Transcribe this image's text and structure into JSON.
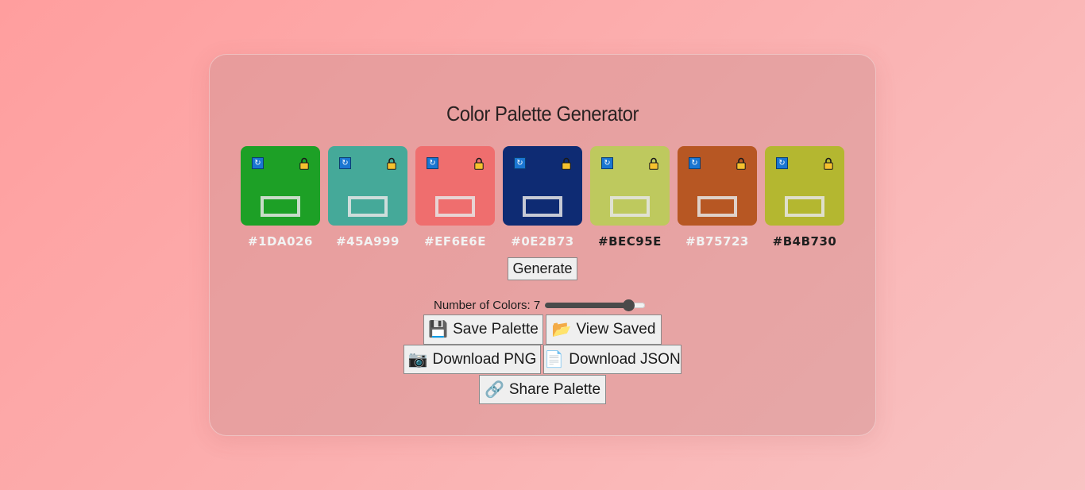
{
  "title": "Color Palette Generator",
  "swatches": [
    {
      "hex": "#1DA026",
      "text_color": "#f2f2f2"
    },
    {
      "hex": "#45A999",
      "text_color": "#f2f2f2"
    },
    {
      "hex": "#EF6E6E",
      "text_color": "#f2f2f2"
    },
    {
      "hex": "#0E2B73",
      "text_color": "#f2f2f2"
    },
    {
      "hex": "#BEC95E",
      "text_color": "#1e1e1e"
    },
    {
      "hex": "#B75723",
      "text_color": "#f2f2f2"
    },
    {
      "hex": "#B4B730",
      "text_color": "#1e1e1e"
    }
  ],
  "icons": {
    "refresh": "refresh-icon",
    "lock": "lock-icon"
  },
  "generate_label": "Generate",
  "count": {
    "label": "Number of Colors: 7",
    "value": 7,
    "min": 2,
    "max": 8
  },
  "actions": {
    "save": {
      "icon": "💾",
      "label": "Save Palette"
    },
    "view": {
      "icon": "📂",
      "label": "View Saved"
    },
    "download_png": {
      "icon": "📷",
      "label": "Download PNG"
    },
    "download_json": {
      "icon": "📄",
      "label": "Download JSON"
    },
    "share": {
      "icon": "🔗",
      "label": "Share Palette"
    }
  }
}
